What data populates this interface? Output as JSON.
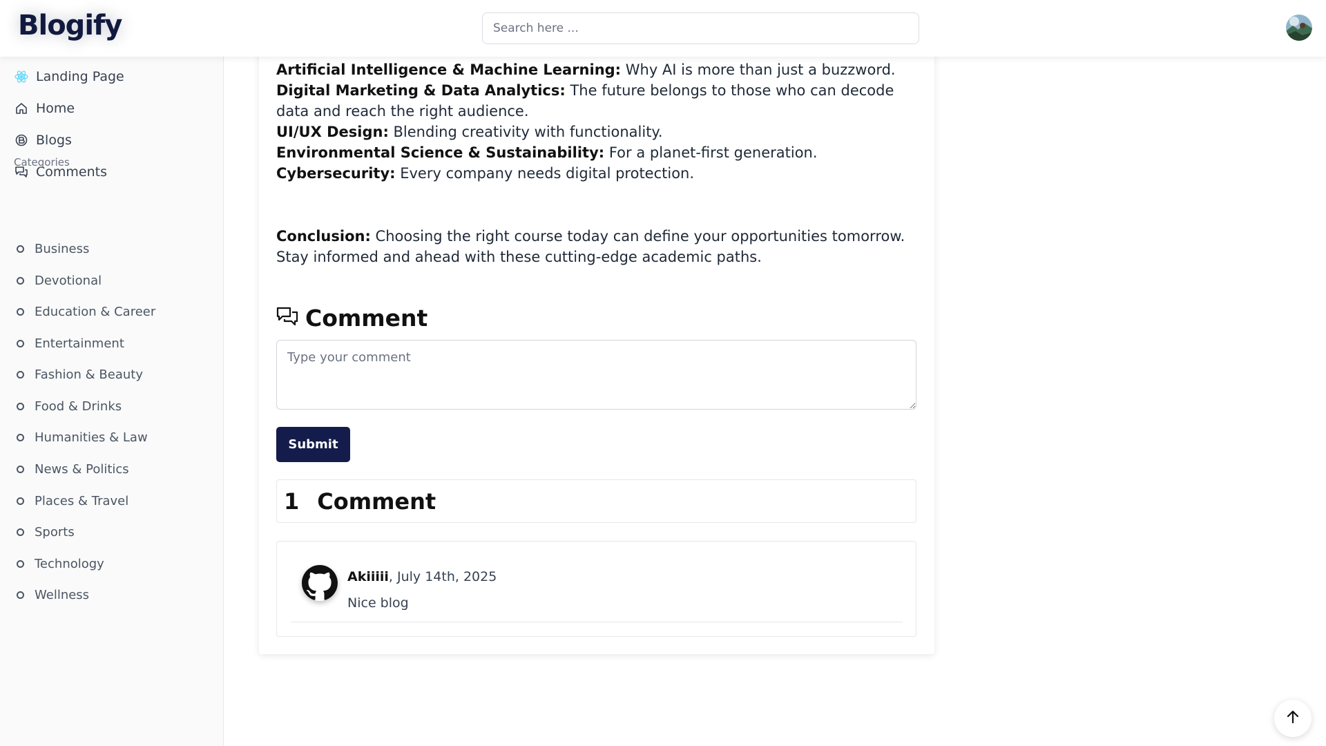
{
  "header": {
    "logo": "Blogify",
    "search_placeholder": "Search here ..."
  },
  "sidebar": {
    "nav": [
      {
        "label": "Landing Page",
        "icon": "react-icon"
      },
      {
        "label": "Home",
        "icon": "home-icon"
      },
      {
        "label": "Blogs",
        "icon": "blog-icon"
      },
      {
        "label": "Comments",
        "icon": "comments-icon"
      }
    ],
    "categories_heading": "Categories",
    "categories": [
      "Business",
      "Devotional",
      "Education & Career",
      "Entertainment",
      "Fashion & Beauty",
      "Food & Drinks",
      "Humanities & Law",
      "News & Politics",
      "Places & Travel",
      "Sports",
      "Technology",
      "Wellness"
    ]
  },
  "article": {
    "items": [
      {
        "label": "Artificial Intelligence & Machine Learning:",
        "text": " Why AI is more than just a buzzword."
      },
      {
        "label": "Digital Marketing & Data Analytics:",
        "text": " The future belongs to those who can decode data and reach the right audience."
      },
      {
        "label": "UI/UX Design:",
        "text": " Blending creativity with functionality."
      },
      {
        "label": "Environmental Science & Sustainability:",
        "text": " For a planet-first generation."
      },
      {
        "label": "Cybersecurity:",
        "text": " Every company needs digital protection."
      }
    ],
    "conclusion_label": "Conclusion:",
    "conclusion_text": " Choosing the right course today can define your opportunities tomorrow. Stay informed and ahead with these cutting-edge academic paths."
  },
  "comments": {
    "heading": "Comment",
    "placeholder": "Type your comment",
    "submit_label": "Submit",
    "count": "1",
    "count_label": "Comment",
    "list": [
      {
        "author": "Akiiiii",
        "date": ", July 14th, 2025",
        "text": "Nice blog"
      }
    ]
  },
  "colors": {
    "brand": "#111a3e",
    "button": "#131c4a"
  }
}
